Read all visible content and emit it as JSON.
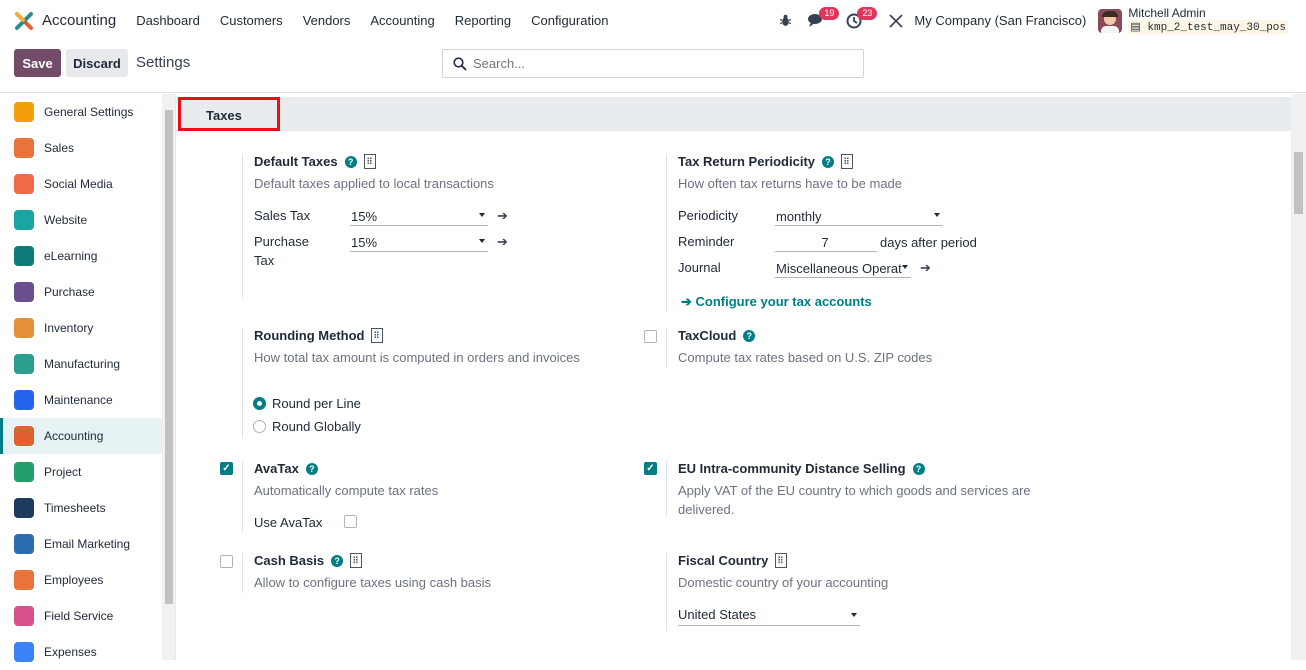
{
  "topbar": {
    "app_name": "Accounting",
    "menu": [
      "Dashboard",
      "Customers",
      "Vendors",
      "Accounting",
      "Reporting",
      "Configuration"
    ],
    "messages_count": "19",
    "activities_count": "23",
    "company": "My Company (San Francisco)",
    "user_name": "Mitchell Admin",
    "db_name": "kmp_2_test_may_30_pos"
  },
  "control": {
    "save": "Save",
    "discard": "Discard",
    "breadcrumb": "Settings",
    "search_placeholder": "Search..."
  },
  "sidebar": {
    "items": [
      {
        "label": "General Settings",
        "color": "#f59e0b"
      },
      {
        "label": "Sales",
        "color": "#e8743b"
      },
      {
        "label": "Social Media",
        "color": "#f06a45"
      },
      {
        "label": "Website",
        "color": "#1aa5a5"
      },
      {
        "label": "eLearning",
        "color": "#0e7a7a"
      },
      {
        "label": "Purchase",
        "color": "#6b4f8c"
      },
      {
        "label": "Inventory",
        "color": "#e69138"
      },
      {
        "label": "Manufacturing",
        "color": "#2a9d8f"
      },
      {
        "label": "Maintenance",
        "color": "#2563eb"
      },
      {
        "label": "Accounting",
        "color": "#e0612f"
      },
      {
        "label": "Project",
        "color": "#22a06b"
      },
      {
        "label": "Timesheets",
        "color": "#1e3a5f"
      },
      {
        "label": "Email Marketing",
        "color": "#2b6cb0"
      },
      {
        "label": "Employees",
        "color": "#e8743b"
      },
      {
        "label": "Field Service",
        "color": "#d94f8a"
      },
      {
        "label": "Expenses",
        "color": "#3b82f6"
      }
    ],
    "active_index": 9
  },
  "section": {
    "title": "Taxes"
  },
  "default_taxes": {
    "title": "Default Taxes",
    "desc": "Default taxes applied to local transactions",
    "sales_label": "Sales Tax",
    "sales_value": "15%",
    "purchase_label_1": "Purchase",
    "purchase_label_2": "Tax",
    "purchase_value": "15%"
  },
  "tax_return": {
    "title": "Tax Return Periodicity",
    "desc": "How often tax returns have to be made",
    "periodicity_label": "Periodicity",
    "periodicity_value": "monthly",
    "reminder_label": "Reminder",
    "reminder_value": "7",
    "reminder_suffix": "days after period",
    "journal_label": "Journal",
    "journal_value": "Miscellaneous Operat",
    "configure_link": "Configure your tax accounts"
  },
  "rounding": {
    "title": "Rounding Method",
    "desc": "How total tax amount is computed in orders and invoices",
    "opt1": "Round per Line",
    "opt2": "Round Globally",
    "selected": "Round per Line"
  },
  "taxcloud": {
    "title": "TaxCloud",
    "desc": "Compute tax rates based on U.S. ZIP codes",
    "checked": false
  },
  "avatax": {
    "title": "AvaTax",
    "desc": "Automatically compute tax rates",
    "use_label": "Use AvaTax",
    "checked": true,
    "use_checked": false
  },
  "eu": {
    "title": "EU Intra-community Distance Selling",
    "desc1": "Apply VAT of the EU country to which goods and services are",
    "desc2": "delivered.",
    "checked": true
  },
  "cash_basis": {
    "title": "Cash Basis",
    "desc": "Allow to configure taxes using cash basis",
    "checked": false
  },
  "fiscal": {
    "title": "Fiscal Country",
    "desc": "Domestic country of your accounting",
    "value": "United States"
  }
}
